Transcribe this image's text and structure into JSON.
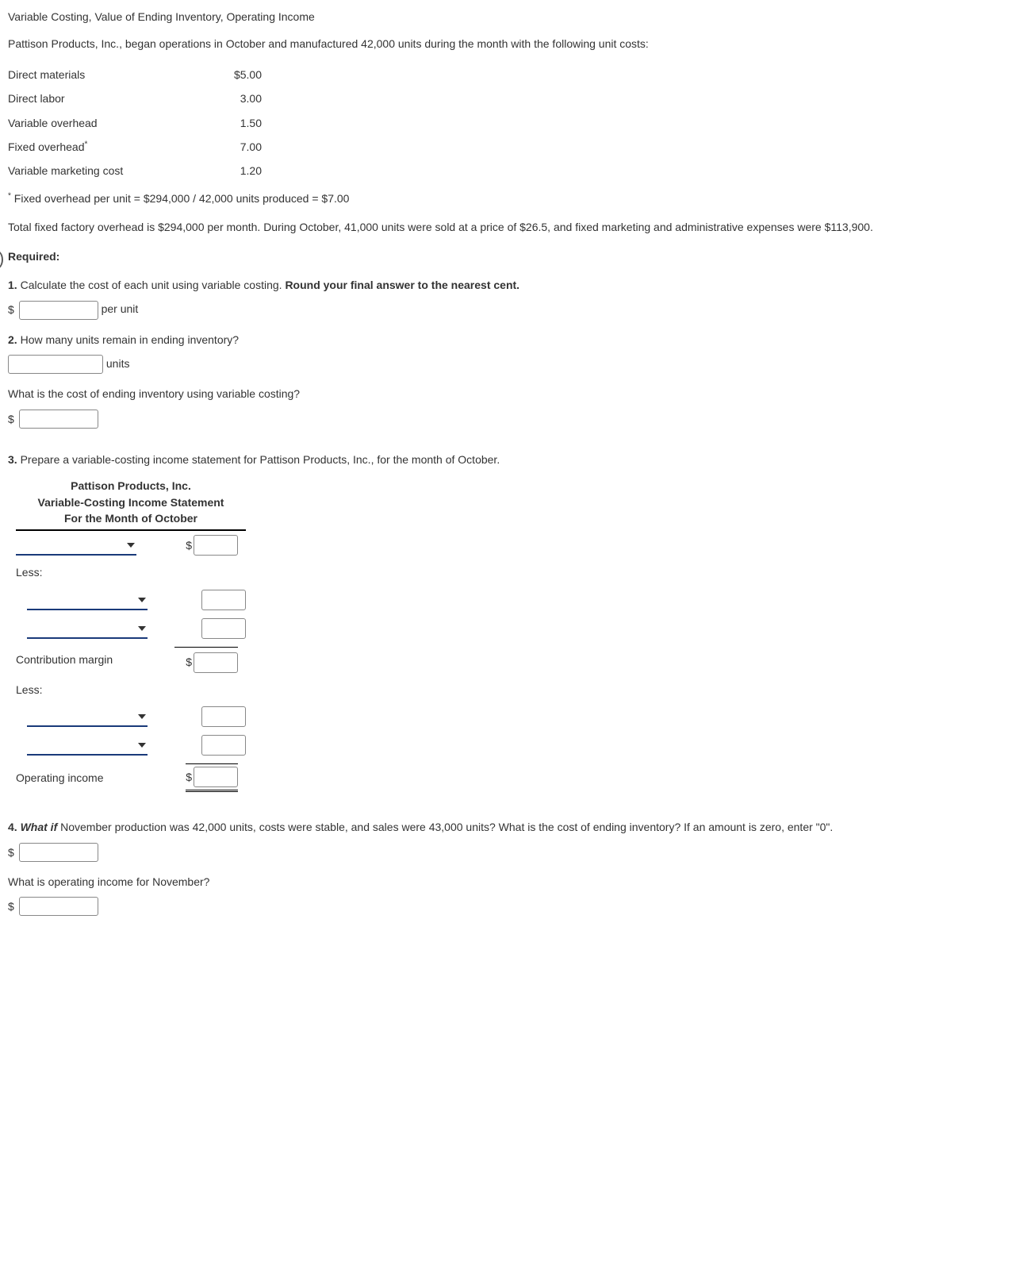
{
  "title": "Variable Costing, Value of Ending Inventory, Operating Income",
  "intro": "Pattison Products, Inc., began operations in October and manufactured 42,000 units during the month with the following unit costs:",
  "costs": [
    {
      "label": "Direct materials",
      "value": "$5.00"
    },
    {
      "label": "Direct labor",
      "value": "3.00"
    },
    {
      "label": "Variable overhead",
      "value": "1.50"
    },
    {
      "label": "Fixed overhead",
      "value": "7.00",
      "sup": "*"
    },
    {
      "label": "Variable marketing cost",
      "value": "1.20"
    }
  ],
  "footnote_sup": "*",
  "footnote": " Fixed overhead per unit = $294,000 / 42,000 units produced = $7.00",
  "body2": "Total fixed factory overhead is $294,000 per month. During October, 41,000 units were sold at a price of $26.5, and fixed marketing and administrative expenses were $113,900.",
  "required_label": "Required:",
  "q1_num": "1.",
  "q1_text": " Calculate the cost of each unit using variable costing. ",
  "q1_bold": "Round your final answer to the nearest cent.",
  "q1_unit": " per unit",
  "q2_num": "2.",
  "q2_text": " How many units remain in ending inventory?",
  "q2_unit": " units",
  "q2b": "What is the cost of ending inventory using variable costing?",
  "q3_num": "3.",
  "q3_text": " Prepare a variable-costing income statement for Pattison Products, Inc., for the month of October.",
  "stmt_h1": "Pattison Products, Inc.",
  "stmt_h2": "Variable-Costing Income Statement",
  "stmt_h3": "For the Month of October",
  "less": "Less:",
  "cm": "Contribution margin",
  "oi": "Operating income",
  "dollar": "$",
  "q4_num": "4.",
  "q4_em": " What if",
  "q4_text": " November production was 42,000 units, costs were stable, and sales were 43,000 units? What is the cost of ending inventory? If an amount is zero, enter \"0\".",
  "q4b": "What is operating income for November?"
}
